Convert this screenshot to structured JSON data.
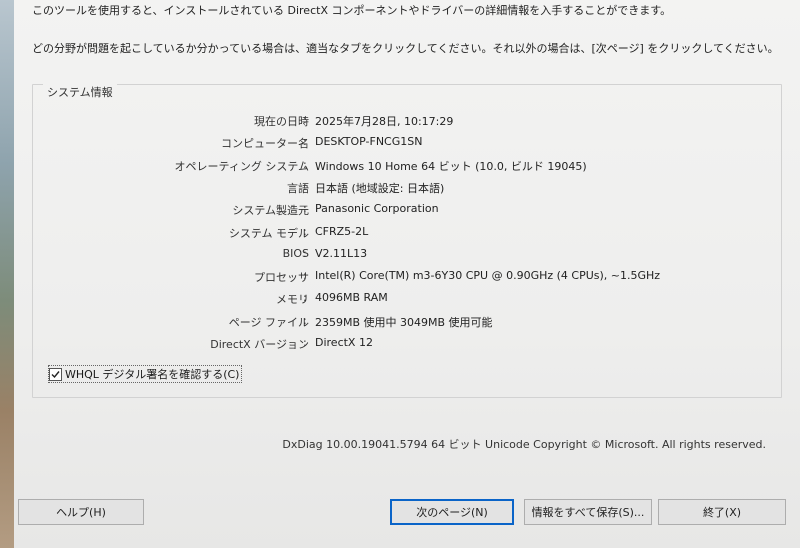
{
  "intro": {
    "line1": "このツールを使用すると、インストールされている DirectX コンポーネントやドライバーの詳細情報を入手することができます。",
    "line2": "どの分野が問題を起こしているか分かっている場合は、適当なタブをクリックしてください。それ以外の場合は、[次ページ] をクリックしてください。"
  },
  "system_info": {
    "title": "システム情報",
    "rows": [
      {
        "label": "現在の日時",
        "value": "2025年7月28日, 10:17:29"
      },
      {
        "label": "コンピューター名",
        "value": "DESKTOP-FNCG1SN"
      },
      {
        "label": "オペレーティング システム",
        "value": "Windows 10 Home 64 ビット (10.0, ビルド 19045)"
      },
      {
        "label": "言語",
        "value": "日本語 (地域設定: 日本語)"
      },
      {
        "label": "システム製造元",
        "value": "Panasonic Corporation"
      },
      {
        "label": "システム モデル",
        "value": "CFRZ5-2L"
      },
      {
        "label": "BIOS",
        "value": "V2.11L13"
      },
      {
        "label": "プロセッサ",
        "value": "Intel(R) Core(TM) m3-6Y30 CPU @ 0.90GHz (4 CPUs), ~1.5GHz"
      },
      {
        "label": "メモリ",
        "value": "4096MB RAM"
      },
      {
        "label": "ページ ファイル",
        "value": "2359MB 使用中 3049MB 使用可能"
      },
      {
        "label": "DirectX バージョン",
        "value": "DirectX 12"
      }
    ],
    "colon": ":"
  },
  "whql": {
    "label": "WHQL デジタル署名を確認する(C)",
    "checked": true
  },
  "footer_note": "DxDiag 10.00.19041.5794 64 ビット Unicode  Copyright © Microsoft. All rights reserved.",
  "buttons": {
    "help": "ヘルプ(H)",
    "next": "次のページ(N)",
    "save": "情報をすべて保存(S)...",
    "exit": "終了(X)"
  }
}
